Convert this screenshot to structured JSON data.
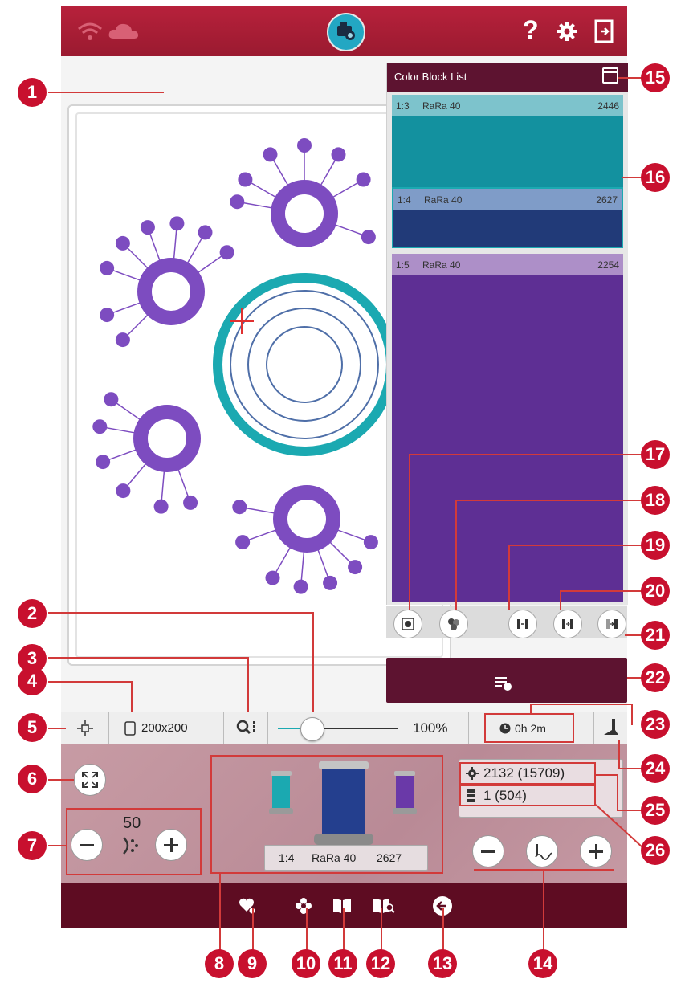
{
  "color_block_list": {
    "title": "Color Block List",
    "blocks": [
      {
        "position": "1:3",
        "thread": "RaRa 40",
        "number": "2446",
        "header_color": "#7dc3cc",
        "body_color": "#13919f"
      },
      {
        "position": "1:4",
        "thread": "RaRa 40",
        "number": "2627",
        "header_color": "#7f9cc8",
        "body_color": "#213a78"
      },
      {
        "position": "1:5",
        "thread": "RaRa 40",
        "number": "2254",
        "header_color": "#ad8fc8",
        "body_color": "#5e2f94"
      }
    ]
  },
  "toolbar": {
    "hoop_size": "200x200",
    "zoom": "100%",
    "time": "0h 2m"
  },
  "speed": {
    "value": "50"
  },
  "thread_info": {
    "position": "1:4",
    "thread": "RaRa 40",
    "number": "2627"
  },
  "stitch_count": {
    "current": "2132 (15709)",
    "block": "1 (504)"
  },
  "callouts": [
    "1",
    "2",
    "3",
    "4",
    "5",
    "6",
    "7",
    "8",
    "9",
    "10",
    "11",
    "12",
    "13",
    "14",
    "15",
    "16",
    "17",
    "18",
    "19",
    "20",
    "21",
    "22",
    "23",
    "24",
    "25",
    "26"
  ],
  "colors": {
    "brand": "#b7213b",
    "panel": "#5d1330",
    "callout": "#c8102e",
    "teal": "#1ba9b1",
    "purple": "#7d4cc0"
  }
}
